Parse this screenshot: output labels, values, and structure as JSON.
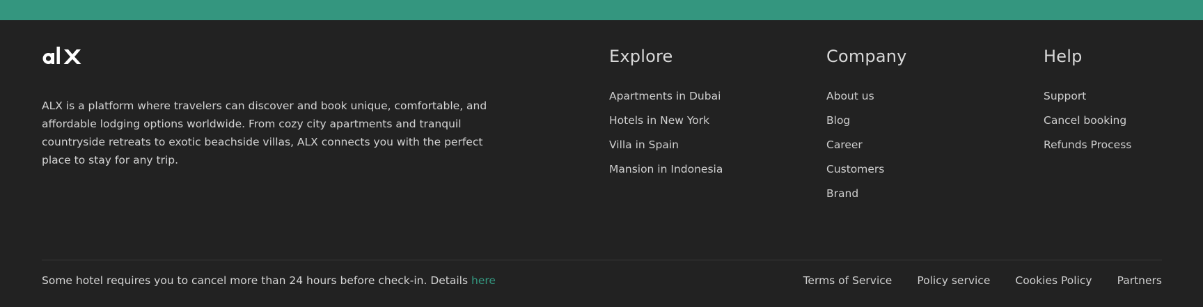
{
  "colors": {
    "accent": "#34967f",
    "background": "#222222",
    "text": "#cfcfcf"
  },
  "brand": {
    "logo_text": "alx"
  },
  "about": {
    "text": "ALX is a platform where travelers can discover and book unique, comfortable, and affordable lodging options worldwide. From cozy city apartments and tranquil countryside retreats to exotic beachside villas, ALX connects you with the perfect place to stay for any trip."
  },
  "columns": {
    "explore": {
      "title": "Explore",
      "items": [
        "Apartments in Dubai",
        "Hotels in New York",
        "Villa in Spain",
        "Mansion in Indonesia"
      ]
    },
    "company": {
      "title": "Company",
      "items": [
        "About us",
        "Blog",
        "Career",
        "Customers",
        "Brand"
      ]
    },
    "help": {
      "title": "Help",
      "items": [
        "Support",
        "Cancel booking",
        "Refunds Process"
      ]
    }
  },
  "notice": {
    "text": "Some hotel requires you to cancel more than 24 hours before check-in. Details ",
    "link": "here"
  },
  "legal_links": [
    "Terms of Service",
    "Policy service",
    "Cookies Policy",
    "Partners"
  ]
}
